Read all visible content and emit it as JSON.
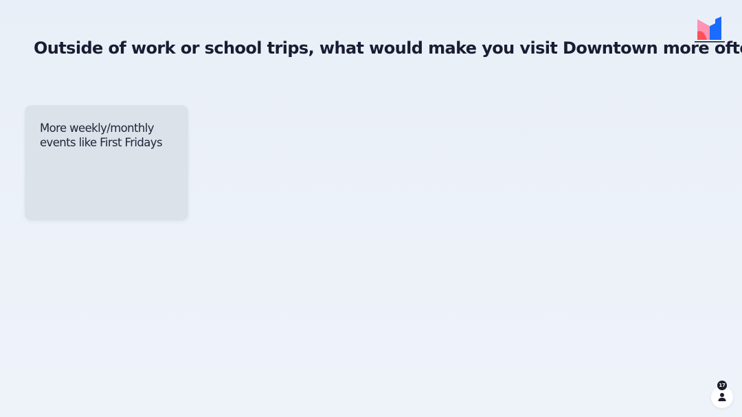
{
  "question": {
    "title": "Outside of work or school trips, what would make you visit Downtown more often?"
  },
  "responses": [
    {
      "text": "More weekly/monthly events like First Fridays"
    }
  ],
  "logo": {
    "icon": "mentimeter-logo-icon",
    "colors": [
      "#ff8fb1",
      "#ff5a5f",
      "#196cff"
    ]
  },
  "participants": {
    "count": "17",
    "icon": "person-icon"
  },
  "colors": {
    "background": "#eaf0f8",
    "card": "#dce2ea",
    "title_text": "#1a1c32",
    "badge": "#1c1d2a"
  }
}
